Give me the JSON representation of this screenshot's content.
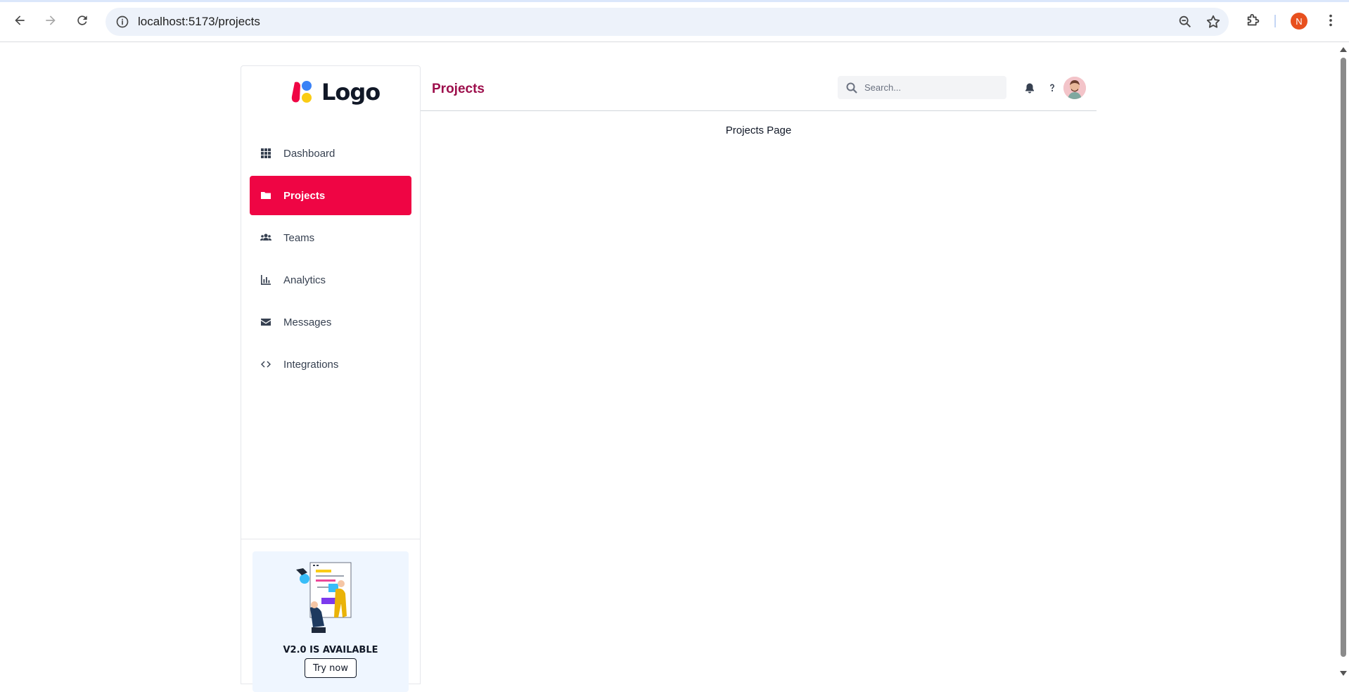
{
  "browser": {
    "url": "localhost:5173/projects",
    "profile_initial": "N",
    "profile_color": "#e8501e"
  },
  "sidebar": {
    "logo_text": "Logo",
    "items": [
      {
        "label": "Dashboard",
        "icon": "grid-icon",
        "active": false
      },
      {
        "label": "Projects",
        "icon": "folder-icon",
        "active": true
      },
      {
        "label": "Teams",
        "icon": "users-icon",
        "active": false
      },
      {
        "label": "Analytics",
        "icon": "bar-chart-icon",
        "active": false
      },
      {
        "label": "Messages",
        "icon": "envelope-icon",
        "active": false
      },
      {
        "label": "Integrations",
        "icon": "code-icon",
        "active": false
      }
    ],
    "promo": {
      "title": "V2.0 IS AVAILABLE",
      "button_label": "Try now"
    }
  },
  "header": {
    "title": "Projects",
    "search_placeholder": "Search..."
  },
  "main": {
    "content": "Projects Page"
  },
  "colors": {
    "accent": "#ef0544",
    "title": "#9d0f4c"
  }
}
